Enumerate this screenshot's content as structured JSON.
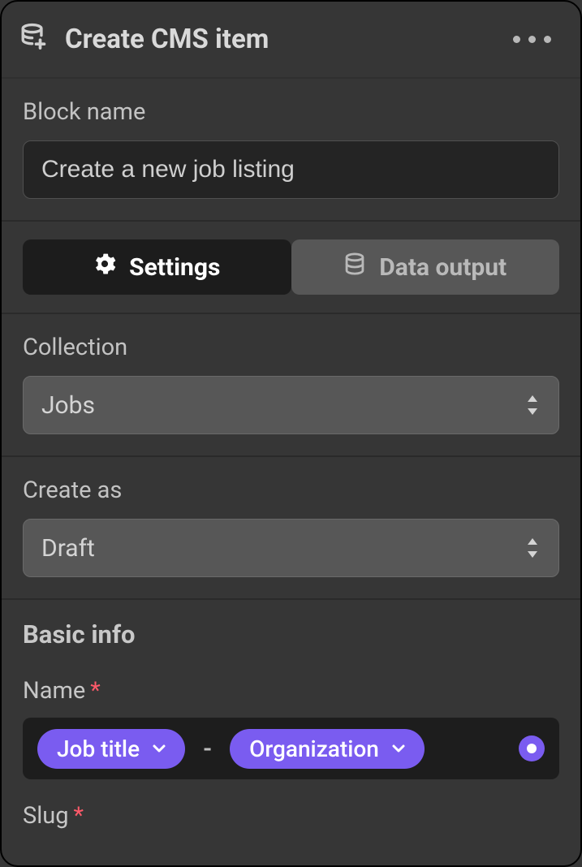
{
  "header": {
    "title": "Create CMS item"
  },
  "blockName": {
    "label": "Block name",
    "value": "Create a new job listing"
  },
  "tabs": {
    "settings": "Settings",
    "output": "Data output"
  },
  "collection": {
    "label": "Collection",
    "value": "Jobs"
  },
  "createAs": {
    "label": "Create as",
    "value": "Draft"
  },
  "basic": {
    "heading": "Basic info",
    "name": {
      "label": "Name",
      "chips": [
        "Job title",
        "Organization"
      ],
      "separator": "-"
    },
    "slug": {
      "label": "Slug"
    }
  }
}
